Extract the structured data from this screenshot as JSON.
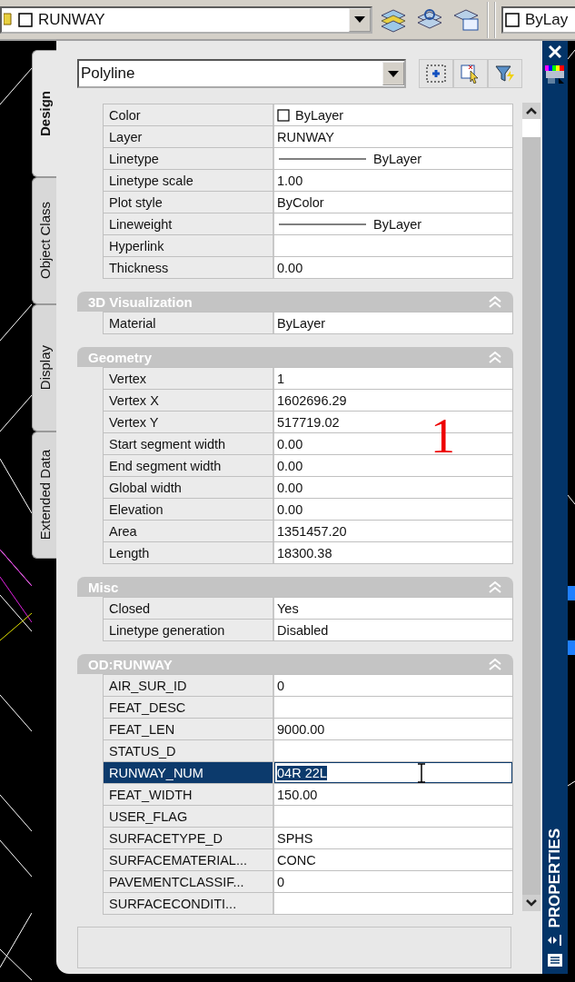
{
  "toolbar": {
    "layer": "RUNWAY",
    "color_control": "ByLay"
  },
  "tabs": [
    {
      "label": "Design",
      "selected": true
    },
    {
      "label": "Object Class",
      "selected": false
    },
    {
      "label": "Display",
      "selected": false
    },
    {
      "label": "Extended Data",
      "selected": false
    }
  ],
  "object_type": "Polyline",
  "sections": [
    {
      "rows": [
        {
          "label": "Color",
          "value": "ByLayer",
          "kind": "swatch",
          "selected": false
        },
        {
          "label": "Layer",
          "value": "RUNWAY",
          "kind": "text",
          "selected": false
        },
        {
          "label": "Linetype",
          "value": "ByLayer",
          "kind": "line",
          "selected": false
        },
        {
          "label": "Linetype scale",
          "value": "1.00",
          "kind": "text",
          "selected": false
        },
        {
          "label": "Plot style",
          "value": "ByColor",
          "kind": "text",
          "selected": false
        },
        {
          "label": "Lineweight",
          "value": "ByLayer",
          "kind": "line",
          "selected": false
        },
        {
          "label": "Hyperlink",
          "kind": "text",
          "selected": false
        },
        {
          "label": "Thickness",
          "value": "0.00",
          "kind": "text",
          "selected": false
        }
      ]
    },
    {
      "title": "3D Visualization",
      "expanded": true,
      "rows": [
        {
          "label": "Material",
          "value": "ByLayer",
          "kind": "text",
          "selected": false
        }
      ]
    },
    {
      "title": "Geometry",
      "expanded": true,
      "rows": [
        {
          "label": "Vertex",
          "value": "1",
          "kind": "text",
          "selected": false
        },
        {
          "label": "Vertex X",
          "value": "1602696.29",
          "kind": "text",
          "selected": false
        },
        {
          "label": "Vertex Y",
          "value": "517719.02",
          "kind": "text",
          "selected": false
        },
        {
          "label": "Start segment width",
          "value": "0.00",
          "kind": "text",
          "selected": false
        },
        {
          "label": "End segment width",
          "value": "0.00",
          "kind": "text",
          "selected": false
        },
        {
          "label": "Global width",
          "value": "0.00",
          "kind": "text",
          "selected": false
        },
        {
          "label": "Elevation",
          "value": "0.00",
          "kind": "text",
          "selected": false
        },
        {
          "label": "Area",
          "value": "1351457.20",
          "kind": "text",
          "selected": false
        },
        {
          "label": "Length",
          "value": "18300.38",
          "kind": "text",
          "selected": false
        }
      ]
    },
    {
      "title": "Misc",
      "expanded": true,
      "rows": [
        {
          "label": "Closed",
          "value": "Yes",
          "kind": "text",
          "selected": false
        },
        {
          "label": "Linetype generation",
          "value": "Disabled",
          "kind": "text",
          "selected": false
        }
      ]
    },
    {
      "title": "OD:RUNWAY",
      "expanded": true,
      "rows": [
        {
          "label": "AIR_SUR_ID",
          "value": "0",
          "kind": "text",
          "selected": false
        },
        {
          "label": "FEAT_DESC",
          "kind": "text",
          "selected": false
        },
        {
          "label": "FEAT_LEN",
          "value": "9000.00",
          "kind": "text",
          "selected": false
        },
        {
          "label": "STATUS_D",
          "kind": "text",
          "selected": false
        },
        {
          "label": "RUNWAY_NUM",
          "value": "04R 22L",
          "kind": "text",
          "selected": true
        },
        {
          "label": "FEAT_WIDTH",
          "value": "150.00",
          "kind": "text",
          "selected": false
        },
        {
          "label": "USER_FLAG",
          "kind": "text",
          "selected": false
        },
        {
          "label": "SURFACETYPE_D",
          "value": "SPHS",
          "kind": "text",
          "selected": false
        },
        {
          "label": "SURFACEMATERIAL...",
          "value": "CONC",
          "kind": "text",
          "selected": false
        },
        {
          "label": "PAVEMENTCLASSIF...",
          "value": "0",
          "kind": "text",
          "selected": false
        },
        {
          "label": "SURFACECONDITI...",
          "kind": "text",
          "selected": false
        }
      ]
    }
  ],
  "annotation": "1",
  "palette_title": "PROPERTIES"
}
